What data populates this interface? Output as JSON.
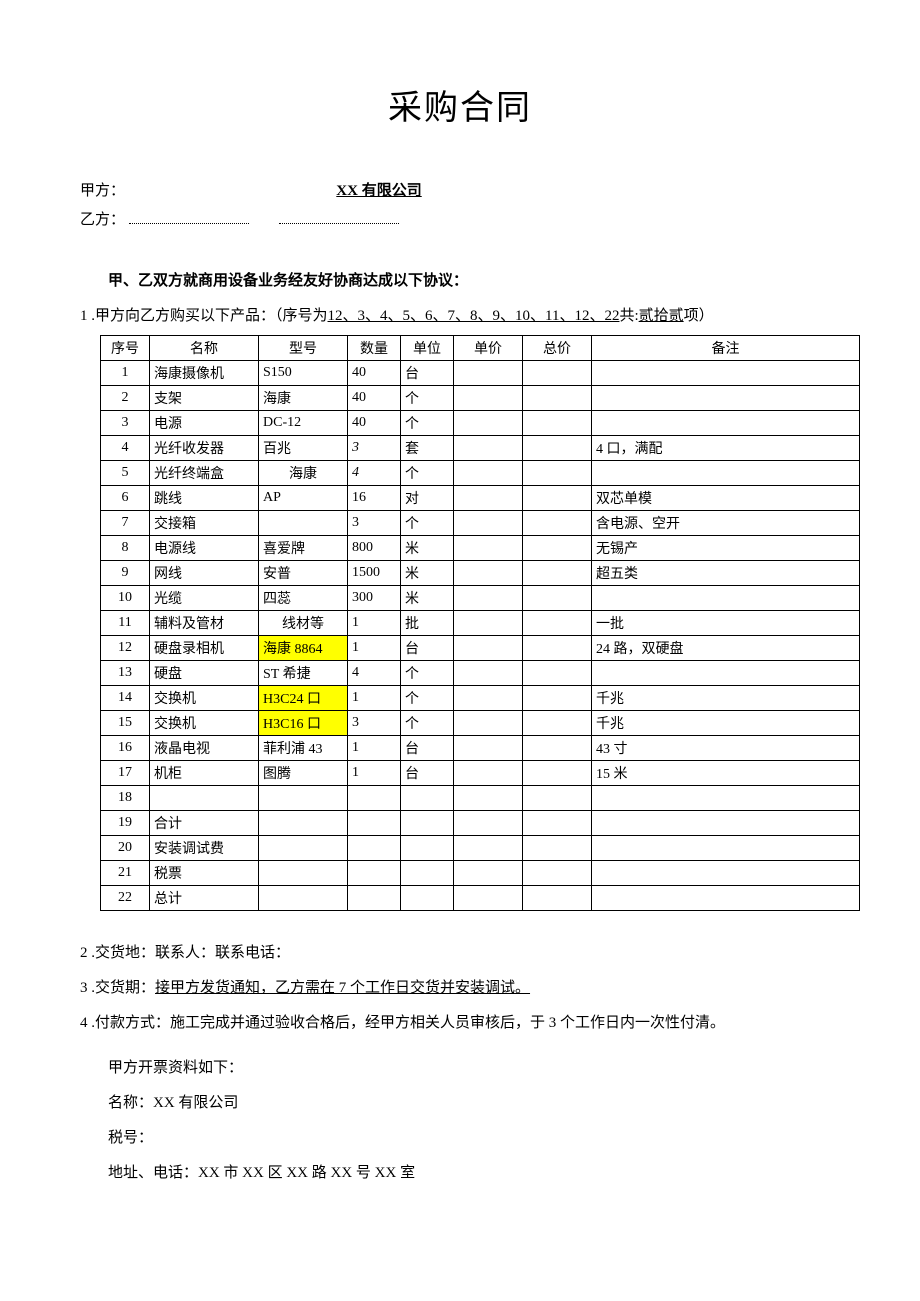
{
  "title": "采购合同",
  "parties": {
    "partyA_label": "甲方：",
    "partyA_value": "XX 有限公司",
    "partyB_label": "乙方："
  },
  "agreement_intro": "甲、乙双方就商用设备业务经友好协商达成以下协议：",
  "clause1": {
    "num": "1",
    "text_a": " .甲方向乙方购买以下产品：（序号为",
    "seq_list": "12、3、4、5、6、7、8、9、10、11、12、22",
    "text_b": "共:",
    "count": "贰拾贰",
    "text_c": "项）"
  },
  "table": {
    "headers": [
      "序号",
      "名称",
      "型号",
      "数量",
      "单位",
      "单价",
      "总价",
      "备注"
    ],
    "rows": [
      {
        "seq": "1",
        "name": "海康摄像机",
        "model": "S150",
        "model_hl": false,
        "qty": "40",
        "qty_it": false,
        "unit": "台",
        "price": "",
        "total": "",
        "note": ""
      },
      {
        "seq": "2",
        "name": "支架",
        "model": "海康",
        "model_hl": false,
        "qty": "40",
        "qty_it": false,
        "unit": "个",
        "price": "",
        "total": "",
        "note": ""
      },
      {
        "seq": "3",
        "name": "电源",
        "model": "DC-12",
        "model_hl": false,
        "qty": "40",
        "qty_it": false,
        "unit": "个",
        "price": "",
        "total": "",
        "note": ""
      },
      {
        "seq": "4",
        "name": "光纤收发器",
        "model": "百兆",
        "model_hl": false,
        "qty": "3",
        "qty_it": true,
        "unit": "套",
        "price": "",
        "total": "",
        "note": "4 口，满配"
      },
      {
        "seq": "5",
        "name": "光纤终端盒",
        "model": "海康",
        "model_hl": false,
        "qty": "4",
        "qty_it": true,
        "unit": "个",
        "price": "",
        "total": "",
        "note": ""
      },
      {
        "seq": "6",
        "name": "跳线",
        "model": "AP",
        "model_hl": false,
        "qty": "16",
        "qty_it": false,
        "unit": "对",
        "price": "",
        "total": "",
        "note": "双芯单模"
      },
      {
        "seq": "7",
        "name": "交接箱",
        "model": "",
        "model_hl": false,
        "qty": "3",
        "qty_it": false,
        "unit": "个",
        "price": "",
        "total": "",
        "note": "含电源、空开"
      },
      {
        "seq": "8",
        "name": "电源线",
        "model": "喜爱牌",
        "model_hl": false,
        "qty": "800",
        "qty_it": false,
        "unit": "米",
        "price": "",
        "total": "",
        "note": "无锡产"
      },
      {
        "seq": "9",
        "name": "网线",
        "model": "安普",
        "model_hl": false,
        "qty": "1500",
        "qty_it": false,
        "unit": "米",
        "price": "",
        "total": "",
        "note": "超五类"
      },
      {
        "seq": "10",
        "name": "光缆",
        "model": "四蕊",
        "model_hl": false,
        "qty": "300",
        "qty_it": false,
        "unit": "米",
        "price": "",
        "total": "",
        "note": ""
      },
      {
        "seq": "11",
        "name": "辅料及管材",
        "model": "线材等",
        "model_hl": false,
        "qty": "1",
        "qty_it": false,
        "unit": "批",
        "price": "",
        "total": "",
        "note": "一批"
      },
      {
        "seq": "12",
        "name": "硬盘录相机",
        "model": "海康 8864",
        "model_hl": true,
        "qty": "1",
        "qty_it": false,
        "unit": "台",
        "price": "",
        "total": "",
        "note": "24 路，双硬盘"
      },
      {
        "seq": "13",
        "name": "硬盘",
        "model": "ST 希捷",
        "model_hl": false,
        "qty": "4",
        "qty_it": false,
        "unit": "个",
        "price": "",
        "total": "",
        "note": ""
      },
      {
        "seq": "14",
        "name": "交换机",
        "model": "H3C24 口",
        "model_hl": true,
        "qty": "1",
        "qty_it": false,
        "unit": "个",
        "price": "",
        "total": "",
        "note": "千兆"
      },
      {
        "seq": "15",
        "name": "交换机",
        "model": "H3C16 口",
        "model_hl": true,
        "qty": "3",
        "qty_it": false,
        "unit": "个",
        "price": "",
        "total": "",
        "note": "千兆"
      },
      {
        "seq": "16",
        "name": "液晶电视",
        "model": "菲利浦 43",
        "model_hl": false,
        "qty": "1",
        "qty_it": false,
        "unit": "台",
        "price": "",
        "total": "",
        "note": "43 寸"
      },
      {
        "seq": "17",
        "name": "机柜",
        "model": "图腾",
        "model_hl": false,
        "qty": "1",
        "qty_it": false,
        "unit": "台",
        "price": "",
        "total": "",
        "note": "15 米"
      },
      {
        "seq": "18",
        "name": "",
        "model": "",
        "model_hl": false,
        "qty": "",
        "qty_it": false,
        "unit": "",
        "price": "",
        "total": "",
        "note": ""
      },
      {
        "seq": "19",
        "name": "合计",
        "model": "",
        "model_hl": false,
        "qty": "",
        "qty_it": false,
        "unit": "",
        "price": "",
        "total": "",
        "note": ""
      },
      {
        "seq": "20",
        "name": "安装调试费",
        "model": "",
        "model_hl": false,
        "qty": "",
        "qty_it": false,
        "unit": "",
        "price": "",
        "total": "",
        "note": ""
      },
      {
        "seq": "21",
        "name": "税票",
        "model": "",
        "model_hl": false,
        "qty": "",
        "qty_it": false,
        "unit": "",
        "price": "",
        "total": "",
        "note": ""
      },
      {
        "seq": "22",
        "name": "总计",
        "model": "",
        "model_hl": false,
        "qty": "",
        "qty_it": false,
        "unit": "",
        "price": "",
        "total": "",
        "note": ""
      }
    ]
  },
  "clause2": {
    "num": "2",
    "text": " .交货地：联系人：联系电话："
  },
  "clause3": {
    "num": "3",
    "text_a": " .交货期：",
    "underline": "接甲方发货通知，乙方需在 7 个工作日交货并安装调试。"
  },
  "clause4": {
    "num": "4",
    "text": " .付款方式：施工完成并通过验收合格后，经甲方相关人员审核后，于 3 个工作日内一次性付清。"
  },
  "invoice": {
    "intro": "甲方开票资料如下：",
    "name": "名称：XX 有限公司",
    "tax": "税号：",
    "addr": "地址、电话：XX 市 XX 区 XX 路 XX 号 XX 室"
  }
}
